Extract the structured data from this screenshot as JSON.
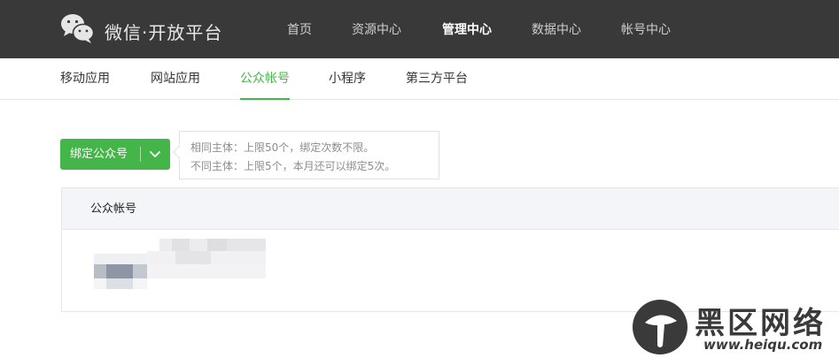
{
  "header": {
    "brand_title": "微信·开放平台",
    "nav": [
      {
        "label": "首页"
      },
      {
        "label": "资源中心"
      },
      {
        "label": "管理中心",
        "active": true
      },
      {
        "label": "数据中心"
      },
      {
        "label": "帐号中心"
      }
    ]
  },
  "subnav": {
    "tabs": [
      {
        "label": "移动应用"
      },
      {
        "label": "网站应用"
      },
      {
        "label": "公众帐号",
        "active": true
      },
      {
        "label": "小程序"
      },
      {
        "label": "第三方平台"
      }
    ]
  },
  "bind_button": {
    "label": "绑定公众号",
    "icon": "chevron-down-icon"
  },
  "tip": {
    "line1": "相同主体：上限50个，绑定次数不限。",
    "line2": "不同主体：上限5个，本月还可以绑定5次。"
  },
  "table": {
    "header": "公众帐号"
  },
  "watermark": {
    "text": "黑区网络",
    "url": "www.heiqu.com"
  },
  "colors": {
    "topbar": "#393939",
    "accent_green": "#44b549",
    "table_header_bg": "#f4f5f9"
  }
}
